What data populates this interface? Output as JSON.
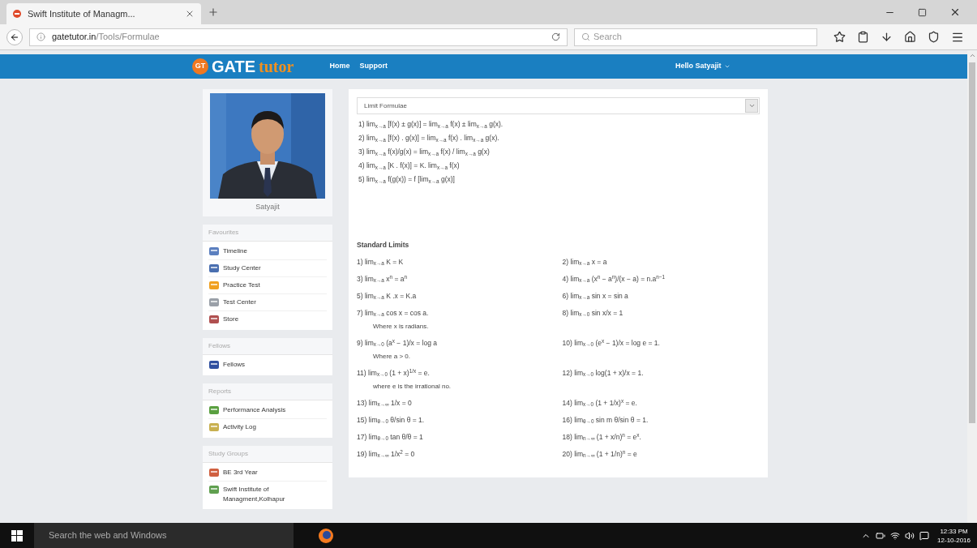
{
  "browser": {
    "tab_title": "Swift Institute of Managm...",
    "url_host": "gatetutor.in",
    "url_path": "/Tools/Formulae",
    "search_placeholder": "Search"
  },
  "nav": {
    "logo_badge": "GT",
    "logo_main": "GATE",
    "logo_accent": "tutor",
    "links": [
      "Home",
      "Support"
    ],
    "user": "Hello Satyajit"
  },
  "profile": {
    "name": "Satyajit"
  },
  "sidebar": [
    {
      "title": "Favourites",
      "items": [
        "Timeline",
        "Study Center",
        "Practice Test",
        "Test Center",
        "Store"
      ]
    },
    {
      "title": "Fellows",
      "items": [
        "Fellows"
      ]
    },
    {
      "title": "Reports",
      "items": [
        "Performance Analysis",
        "Activity Log"
      ]
    },
    {
      "title": "Study Groups",
      "items": [
        "BE 3rd Year",
        "Swift Institute of Managment,Kolhapur"
      ]
    }
  ],
  "content": {
    "select_value": "Limit Formulae",
    "formulas": [
      "1) lim$_{x→a}$ [f(x) ± g(x)] = lim$_{x→a}$ f(x) ± lim$_{x→a}$ g(x).",
      "2) lim$_{x→a}$ [f(x) . g(x)] = lim$_{x→a}$ f(x) . lim$_{x→a}$ g(x).",
      "3) lim$_{x→a}$ f(x)/g(x) = lim$_{x→a}$ f(x) / lim$_{x→a}$ g(x)",
      "4) lim$_{x→a}$ [K . f(x)] = K. lim$_{x→a}$ f(x)",
      "5) lim$_{x→a}$ f(g(x)) = f [lim$_{x→a}$ g(x)]"
    ],
    "standard_heading": "Standard Limits",
    "standard": [
      {
        "formula": "1) lim$_{x→a}$ K = K"
      },
      {
        "formula": "2) lim$_{x→a}$ x = a"
      },
      {
        "formula": "3) lim$_{x→a}$ x$^{n}$ = a$^{n}$"
      },
      {
        "formula": "4) lim$_{x→a}$ (x$^{n}$ − a$^{n}$)/(x − a) = n.a$^{n−1}$"
      },
      {
        "formula": "5) lim$_{x→a}$ K .x = K.a"
      },
      {
        "formula": "6) lim$_{x→a}$ sin x = sin a"
      },
      {
        "formula": "7) lim$_{x→a}$ cos x = cos a.",
        "note": "Where x is radians."
      },
      {
        "formula": "8) lim$_{x→0}$ sin x/x = 1"
      },
      {
        "formula": "9) lim$_{x→0}$ (a$^{x}$ − 1)/x = log a",
        "note": "Where a > 0."
      },
      {
        "formula": "10) lim$_{x→0}$ (e$^{x}$ − 1)/x = log e = 1."
      },
      {
        "formula": "11) lim$_{x→0}$ (1 + x)$^{1/x}$ = e.",
        "note": "where e is the irrational no."
      },
      {
        "formula": "12) lim$_{x→0}$ log(1 + x)/x = 1."
      },
      {
        "formula": "13) lim$_{x→∞}$ 1/x = 0"
      },
      {
        "formula": "14) lim$_{x→0}$ (1 + 1/x)$^{x}$ = e."
      },
      {
        "formula": "15) lim$_{θ→0}$ θ/sin θ = 1."
      },
      {
        "formula": "16) lim$_{θ→0}$ sin m θ/sin θ = 1."
      },
      {
        "formula": "17) lim$_{θ→0}$ tan θ/θ = 1"
      },
      {
        "formula": "18) lim$_{n→∞}$ (1 + x/n)$^{n}$ = e$^{x}$."
      },
      {
        "formula": "19) lim$_{x→∞}$ 1/x$^{2}$ = 0"
      },
      {
        "formula": "20) lim$_{n→∞}$ (1 + 1/n)$^{n}$ = e"
      }
    ]
  },
  "taskbar": {
    "search_placeholder": "Search the web and Windows",
    "time": "12:33 PM",
    "date": "12-10-2016"
  }
}
